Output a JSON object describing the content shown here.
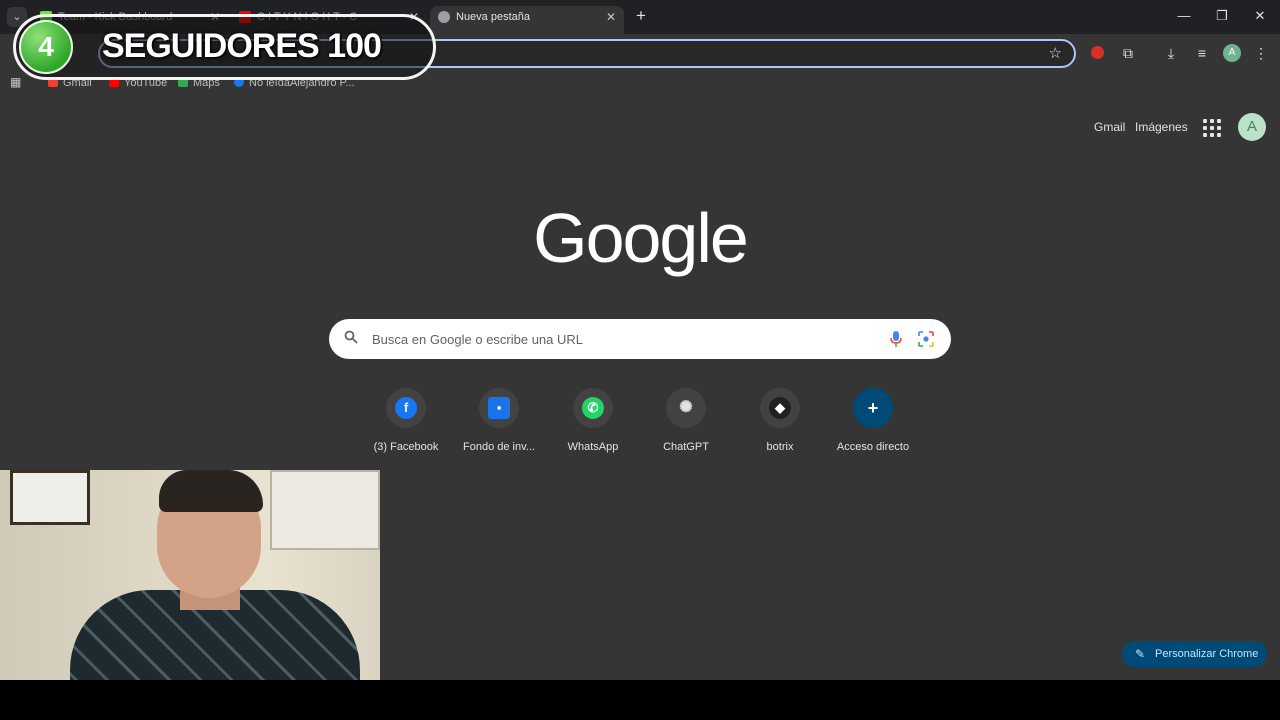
{
  "tabs": [
    {
      "title": "Team - Kick Dashboard",
      "close": "✕"
    },
    {
      "title": "C I T Y   N I G H T - C",
      "close": "✕"
    },
    {
      "title": "Nueva pestaña",
      "close": "✕"
    }
  ],
  "new_tab": "+",
  "window_controls": {
    "minimize": "—",
    "restore": "❐",
    "close": "✕"
  },
  "bookmarks": [
    {
      "label": "Gmail",
      "color": "#ea4335"
    },
    {
      "label": "YouTube",
      "color": "#ff0000"
    },
    {
      "label": "Maps",
      "color": "#34a853"
    },
    {
      "label": "No leídaAlejandro P...",
      "color": "#1877f2"
    }
  ],
  "overlay": {
    "badge": "4",
    "text": "SEGUIDORES 100"
  },
  "ntp": {
    "gmail": "Gmail",
    "images": "Imágenes",
    "logo": "Google",
    "search_placeholder": "Busca en Google o escribe una URL",
    "customize": "Personalizar Chrome"
  },
  "shortcuts": [
    {
      "label": "(3) Facebook",
      "glyph": "f",
      "color": "#1877f2"
    },
    {
      "label": "Fondo de inv...",
      "glyph": "▪",
      "color": "#1a73e8"
    },
    {
      "label": "WhatsApp",
      "glyph": "✆",
      "color": "#25d366"
    },
    {
      "label": "ChatGPT",
      "glyph": "✺",
      "color": "#424242"
    },
    {
      "label": "botrix",
      "glyph": "◆",
      "color": "#202124"
    },
    {
      "label": "Acceso directo",
      "glyph": "+",
      "color": "#004a77"
    }
  ]
}
